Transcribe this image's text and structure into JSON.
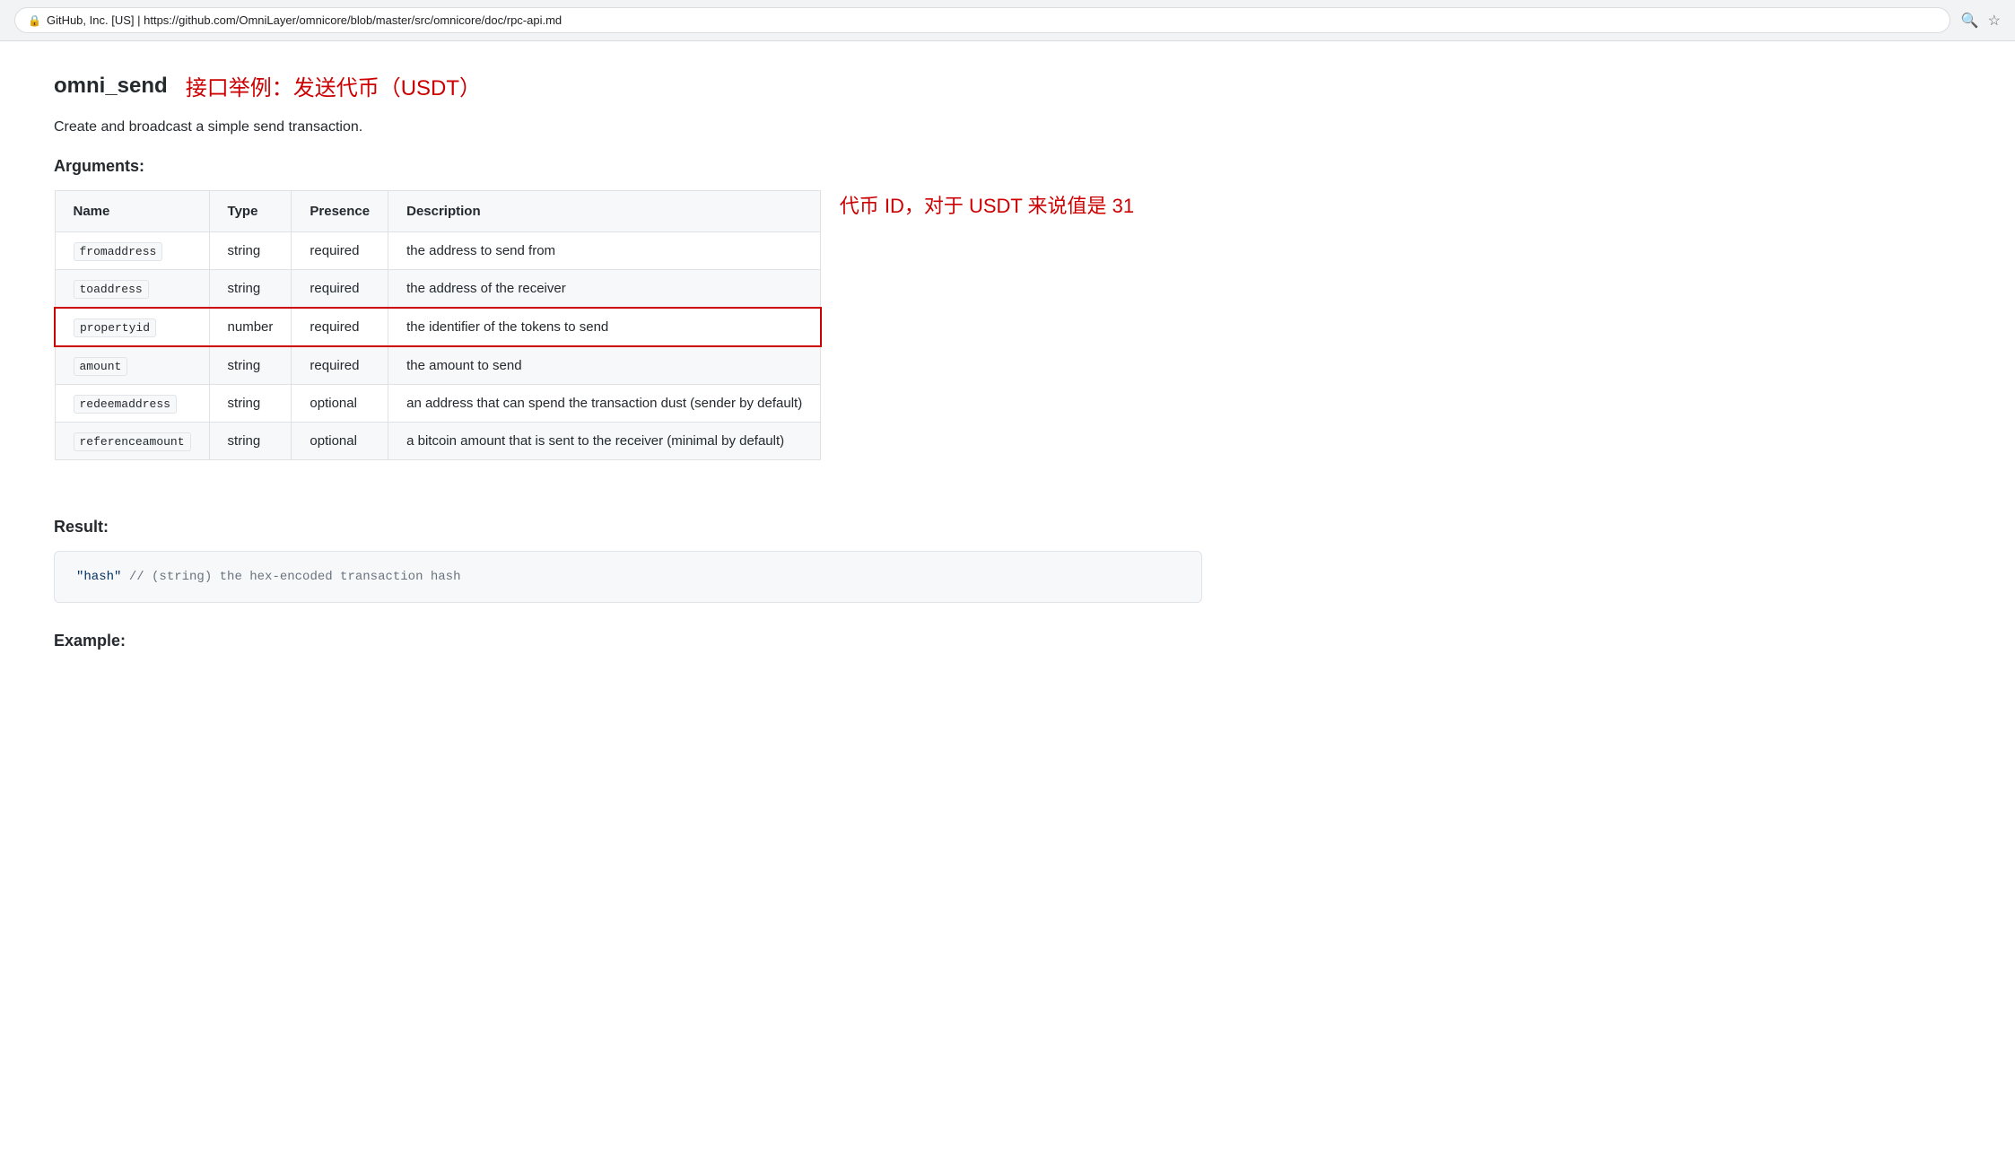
{
  "browser": {
    "security_label": "GitHub, Inc. [US]",
    "url_host": "https://github.com",
    "url_path": "/OmniLayer/omnicore/blob/master/src/omnicore/doc/rpc-api.md",
    "url_full": "https://github.com/OmniLayer/omnicore/blob/master/src/omnicore/doc/rpc-api.md"
  },
  "page": {
    "function_name": "omni_send",
    "title_annotation": "接口举例：发送代币（USDT）",
    "description": "Create and broadcast a simple send transaction.",
    "arguments_heading": "Arguments:",
    "result_heading": "Result:",
    "example_heading": "Example:"
  },
  "table": {
    "headers": [
      "Name",
      "Type",
      "Presence",
      "Description"
    ],
    "rows": [
      {
        "name": "fromaddress",
        "type": "string",
        "presence": "required",
        "description": "the address to send from",
        "highlighted": false
      },
      {
        "name": "toaddress",
        "type": "string",
        "presence": "required",
        "description": "the address of the receiver",
        "highlighted": false
      },
      {
        "name": "propertyid",
        "type": "number",
        "presence": "required",
        "description": "the identifier of the tokens to send",
        "highlighted": true
      },
      {
        "name": "amount",
        "type": "string",
        "presence": "required",
        "description": "the amount to send",
        "highlighted": false
      },
      {
        "name": "redeemaddress",
        "type": "string",
        "presence": "optional",
        "description": "an address that can spend the transaction dust (sender by default)",
        "highlighted": false
      },
      {
        "name": "referenceamount",
        "type": "string",
        "presence": "optional",
        "description": "a bitcoin amount that is sent to the receiver (minimal by default)",
        "highlighted": false
      }
    ]
  },
  "annotation": {
    "propertyid_note": "代币 ID，对于 USDT 来说值是 31"
  },
  "result": {
    "code": "\"hash\"  // (string) the hex-encoded transaction hash"
  }
}
